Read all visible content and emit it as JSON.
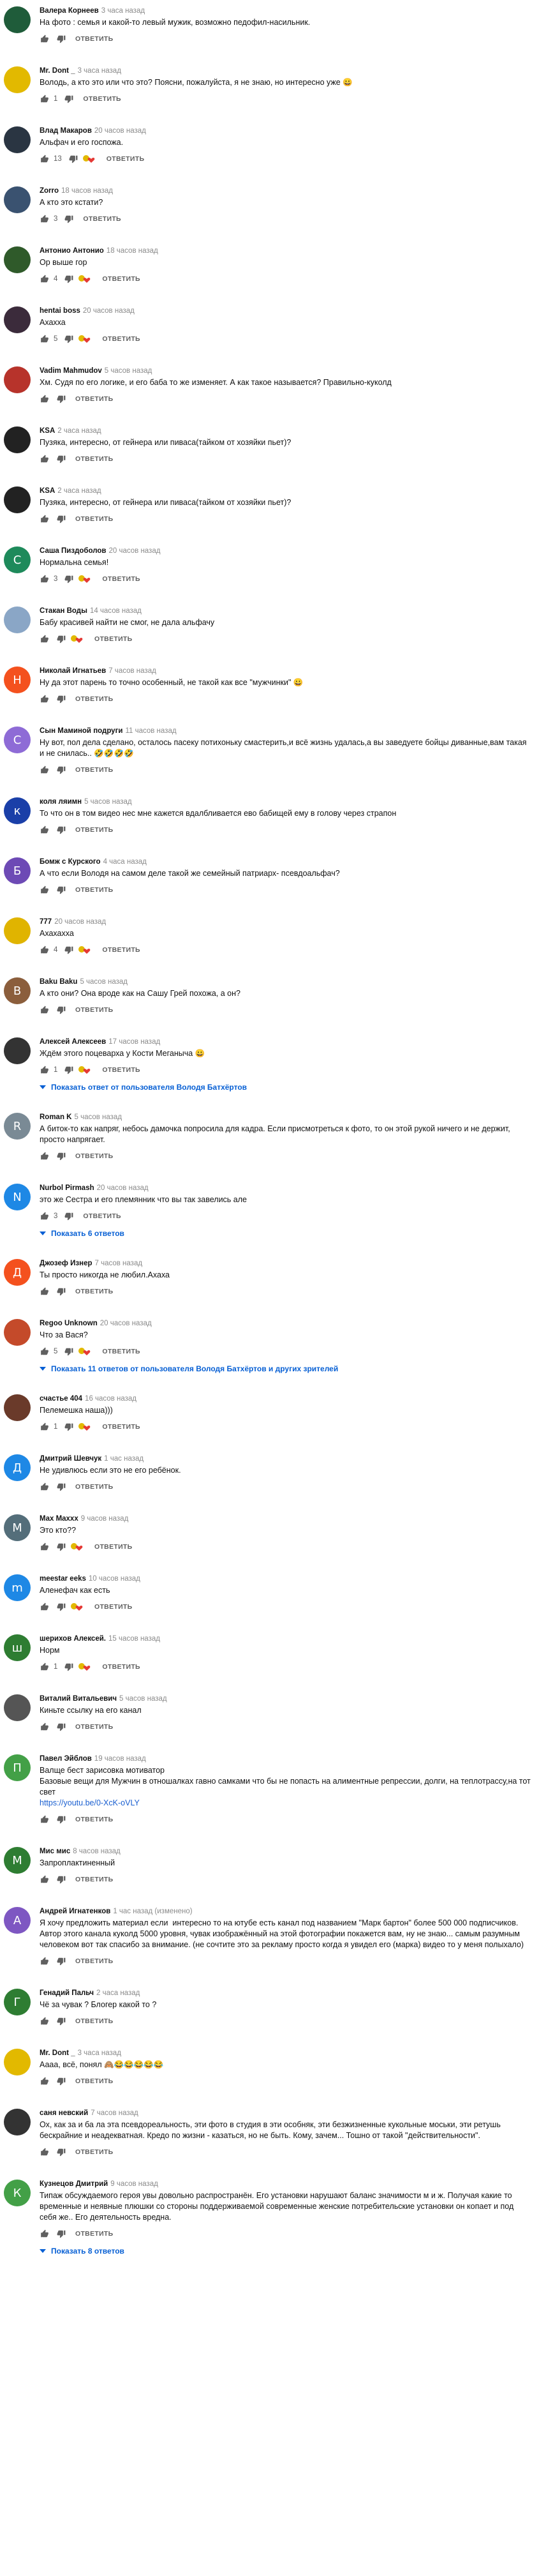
{
  "reply_label": "ОТВЕТИТЬ",
  "comments": [
    {
      "author": "Валера Корнеев",
      "time": "3 часа назад",
      "text": "На фото : семья и какой-то левый мужик, возможно педофил-насильник.",
      "likes": "",
      "heart": false,
      "avatar_letter": "",
      "avatar_color": "#1f5c3a",
      "more": ""
    },
    {
      "author": "Mr. Dont _",
      "time": "3 часа назад",
      "text": "Володь, а кто это или что это? Поясни, пожалуйста, я не знаю, но интересно уже 😀",
      "likes": "1",
      "heart": false,
      "avatar_letter": "",
      "avatar_color": "#e2b900",
      "more": ""
    },
    {
      "author": "Влад Макаров",
      "time": "20 часов назад",
      "text": "Альфач и его госпожа.",
      "likes": "13",
      "heart": true,
      "avatar_letter": "",
      "avatar_color": "#2a3542",
      "more": ""
    },
    {
      "author": "Zorro",
      "time": "18 часов назад",
      "text": "А кто это кстати?",
      "likes": "3",
      "heart": false,
      "avatar_letter": "",
      "avatar_color": "#3a5270",
      "more": ""
    },
    {
      "author": "Антонио Антонио",
      "time": "18 часов назад",
      "text": "Ор выше гор",
      "likes": "4",
      "heart": true,
      "avatar_letter": "",
      "avatar_color": "#2f5a2a",
      "more": ""
    },
    {
      "author": "hentai boss",
      "time": "20 часов назад",
      "text": "Ахахха",
      "likes": "5",
      "heart": true,
      "avatar_letter": "",
      "avatar_color": "#3b2b3b",
      "more": ""
    },
    {
      "author": "Vadim Mahmudov",
      "time": "5 часов назад",
      "text": "Хм. Судя по его логике, и его баба то же изменяет. А как такое называется? Правильно-куколд",
      "likes": "",
      "heart": false,
      "avatar_letter": "",
      "avatar_color": "#b7332b",
      "more": ""
    },
    {
      "author": "KSA",
      "time": "2 часа назад",
      "text": "Пузяка, интересно, от гейнера или пиваса(тайком от хозяйки пьет)?",
      "likes": "",
      "heart": false,
      "avatar_letter": "",
      "avatar_color": "#222",
      "more": ""
    },
    {
      "author": "KSA",
      "time": "2 часа назад",
      "text": "Пузяка, интересно, от гейнера или пиваса(тайком от хозяйки пьет)?",
      "likes": "",
      "heart": false,
      "avatar_letter": "",
      "avatar_color": "#222",
      "more": ""
    },
    {
      "author": "Саша Пиздоболов",
      "time": "20 часов назад",
      "text": "Нормальна семья!",
      "likes": "3",
      "heart": true,
      "avatar_letter": "С",
      "avatar_color": "#1e8a5b",
      "more": ""
    },
    {
      "author": "Стакан Воды",
      "time": "14 часов назад",
      "text": "Бабу красивей найти не смог, не дала альфачу",
      "likes": "",
      "heart": true,
      "avatar_letter": "",
      "avatar_color": "#8aa6c6",
      "more": ""
    },
    {
      "author": "Николай Игнатьев",
      "time": "7 часов назад",
      "text": "Ну да этот парень то точно особенный, не такой как все \"мужчинки\" 😀",
      "likes": "",
      "heart": false,
      "avatar_letter": "Н",
      "avatar_color": "#f4511e",
      "more": ""
    },
    {
      "author": "Сын Маминой подруги",
      "time": "11 часов назад",
      "text": "Ну вот, пол дела сделано, осталось пасеку потихоньку смастерить,и всё жизнь удалась,а вы заведуете бойцы диванные,вам такая и не снилась.. 🤣🤣🤣🤣",
      "likes": "",
      "heart": false,
      "avatar_letter": "С",
      "avatar_color": "#8e6bd6",
      "more": ""
    },
    {
      "author": "коля ляимн",
      "time": "5 часов назад",
      "text": "То что он в том видео нес мне кажется вдалбливается ево бабищей ему в голову через страпон",
      "likes": "",
      "heart": false,
      "avatar_letter": "к",
      "avatar_color": "#1a3fa8",
      "more": ""
    },
    {
      "author": "Бомж с Курского",
      "time": "4 часа назад",
      "text": "А что если Володя на самом деле такой же семейный патриарх- псевдоальфач?",
      "likes": "",
      "heart": false,
      "avatar_letter": "Б",
      "avatar_color": "#6d4ab5",
      "more": ""
    },
    {
      "author": "777",
      "time": "20 часов назад",
      "text": "Ахахахха",
      "likes": "4",
      "heart": true,
      "avatar_letter": "",
      "avatar_color": "#e0b400",
      "more": ""
    },
    {
      "author": "Baku Baku",
      "time": "5 часов назад",
      "text": "А кто они? Она вроде как на Сашу Грей похожа, а он?",
      "likes": "",
      "heart": false,
      "avatar_letter": "B",
      "avatar_color": "#8b5e3c",
      "more": ""
    },
    {
      "author": "Алексей Алексеев",
      "time": "17 часов назад",
      "text": "Ждём этого поцеварха у Кости Меганыча 😀",
      "likes": "1",
      "heart": true,
      "avatar_letter": "",
      "avatar_color": "#333",
      "more": "Показать ответ от пользователя Володя Батхёртов"
    },
    {
      "author": "Roman K",
      "time": "5 часов назад",
      "text": "А биток-то как напряг, небось дамочка попросила для кадра. Если присмотреться к фото, то он этой рукой ничего и не держит, просто напрягает.",
      "likes": "",
      "heart": false,
      "avatar_letter": "R",
      "avatar_color": "#7a8a95",
      "more": ""
    },
    {
      "author": "Nurbol Pirmash",
      "time": "20 часов назад",
      "text": "это же Сестра и его племянник что вы так завелись але",
      "likes": "3",
      "heart": false,
      "avatar_letter": "N",
      "avatar_color": "#1e88e5",
      "more": "Показать 6 ответов"
    },
    {
      "author": "Джозеф Изнер",
      "time": "7 часов назад",
      "text": "Ты просто никогда не любил.Ахаха",
      "likes": "",
      "heart": false,
      "avatar_letter": "Д",
      "avatar_color": "#f4511e",
      "more": ""
    },
    {
      "author": "Regoo Unknown",
      "time": "20 часов назад",
      "text": "Что за Вася?",
      "likes": "5",
      "heart": true,
      "avatar_letter": "",
      "avatar_color": "#c44a2a",
      "more": "Показать 11 ответов от пользователя Володя Батхёртов и других зрителей"
    },
    {
      "author": "счастье 404",
      "time": "16 часов назад",
      "text": "Пелемешка наша)))",
      "likes": "1",
      "heart": true,
      "avatar_letter": "",
      "avatar_color": "#6a3a2a",
      "more": ""
    },
    {
      "author": "Дмитрий Шевчук",
      "time": "1 час назад",
      "text": "Не удивлюсь если это не его ребёнок.",
      "likes": "",
      "heart": false,
      "avatar_letter": "Д",
      "avatar_color": "#1e88e5",
      "more": ""
    },
    {
      "author": "Max Maxxx",
      "time": "9 часов назад",
      "text": "Это кто??",
      "likes": "",
      "heart": true,
      "avatar_letter": "M",
      "avatar_color": "#546e7a",
      "more": ""
    },
    {
      "author": "meestar eeks",
      "time": "10 часов назад",
      "text": "Аленефач как есть",
      "likes": "",
      "heart": true,
      "avatar_letter": "m",
      "avatar_color": "#1e88e5",
      "more": ""
    },
    {
      "author": "шерихов Алексей.",
      "time": "15 часов назад",
      "text": "Норм",
      "likes": "1",
      "heart": true,
      "avatar_letter": "ш",
      "avatar_color": "#2e7d32",
      "more": ""
    },
    {
      "author": "Виталий Витальевич",
      "time": "5 часов назад",
      "text": "Киньте ссылку на его канал",
      "likes": "",
      "heart": false,
      "avatar_letter": "",
      "avatar_color": "#555",
      "more": ""
    },
    {
      "author": "Павел Эйблов",
      "time": "19 часов назад",
      "text": "Валще бест зарисовка мотиватор\nБазовые вещи для Мужчин в отношалках гавно самками что бы не попасть на алиментные репрессии, долги, на теплотрассу,на тот свет\n",
      "link": "https://youtu.be/0-XcK-oVLY",
      "likes": "",
      "heart": false,
      "avatar_letter": "П",
      "avatar_color": "#43a047",
      "more": ""
    },
    {
      "author": "Мис мис",
      "time": "8 часов назад",
      "text": "Запроплактиненный",
      "likes": "",
      "heart": false,
      "avatar_letter": "М",
      "avatar_color": "#2e7d32",
      "more": ""
    },
    {
      "author": "Андрей Игнатенков",
      "time": "1 час назад (изменено)",
      "text": "Я хочу предложить материал если  интересно то на ютубе есть канал под названием \"Марк бартон\" более 500 000 подписчиков. Автор этого канала куколд 5000 уровня, чувак изображённый на этой фотографии покажется вам, ну не знаю... самым разумным человеком вот так спасибо за внимание. (не сочтите это за рекламу просто когда я увидел его (марка) видео то у меня полыхало)",
      "likes": "",
      "heart": false,
      "avatar_letter": "А",
      "avatar_color": "#7e57c2",
      "more": ""
    },
    {
      "author": "Генадий Пальч",
      "time": "2 часа назад",
      "text": "Чё за чувак ? Блогер какой то ?",
      "likes": "",
      "heart": false,
      "avatar_letter": "Г",
      "avatar_color": "#2e7d32",
      "more": ""
    },
    {
      "author": "Mr. Dont _",
      "time": "3 часа назад",
      "text": "Аааа, всё, понял 🙈😂😂😂😂😂",
      "likes": "",
      "heart": false,
      "avatar_letter": "",
      "avatar_color": "#e2b900",
      "more": ""
    },
    {
      "author": "саня невский",
      "time": "7 часов назад",
      "text": "Ох, как за и ба ла эта псевдореальность, эти фото в студия в эти особняк, эти безжизненные кукольные моськи, эти ретушь бескрайние и неадекватная. Кредо по жизни - казаться, но не быть. Кому, зачем... Тошно от такой \"действительности\".",
      "likes": "",
      "heart": false,
      "avatar_letter": "",
      "avatar_color": "#333",
      "more": ""
    },
    {
      "author": "Кузнецов Дмитрий",
      "time": "9 часов назад",
      "text": "Типаж обсуждаемого героя увы довольно распространён. Его установки нарушают баланс значимости м и ж. Получая какие то временные и неявные плюшки со стороны поддерживаемой современные женские потребительские установки он копает и под себя же.. Его деятельность вредна.",
      "likes": "",
      "heart": false,
      "avatar_letter": "К",
      "avatar_color": "#43a047",
      "more": "Показать 8 ответов"
    }
  ],
  "icons": {
    "like": "thumbs-up-icon",
    "dislike": "thumbs-down-icon",
    "heart": "creator-heart-icon",
    "expand": "caret-down-icon"
  }
}
